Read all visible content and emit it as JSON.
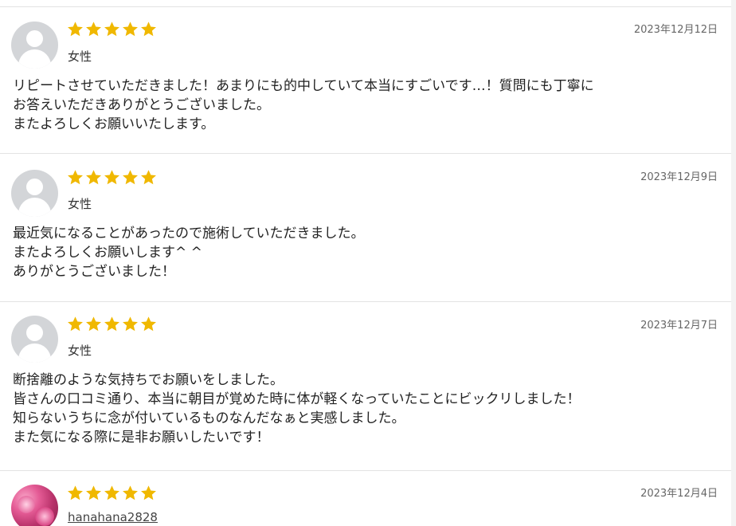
{
  "colors": {
    "star": "#f0b800",
    "border": "#e3e3e3",
    "date": "#666666"
  },
  "reviews": [
    {
      "avatar": "default-user-icon",
      "rating": 5,
      "reviewer": "女性",
      "date": "2023年12月12日",
      "lines": [
        "リピートさせていただきました！あまりにも的中していて本当にすごいです…！質問にも丁寧に",
        "お答えいただきありがとうございました。",
        "またよろしくお願いいたします。"
      ]
    },
    {
      "avatar": "default-user-icon",
      "rating": 5,
      "reviewer": "女性",
      "date": "2023年12月9日",
      "lines": [
        "最近気になることがあったので施術していただきました。",
        "またよろしくお願いします^ ^",
        "ありがとうございました！"
      ]
    },
    {
      "avatar": "default-user-icon",
      "rating": 5,
      "reviewer": "女性",
      "date": "2023年12月7日",
      "lines": [
        "断捨離のような気持ちでお願いをしました。",
        "皆さんの口コミ通り、本当に朝目が覚めた時に体が軽くなっていたことにビックリしました！",
        "知らないうちに念が付いているものなんだなぁと実感しました。",
        "また気になる際に是非お願いしたいです！"
      ]
    },
    {
      "avatar": "user-photo-icon",
      "rating": 5,
      "reviewer": "hanahana2828",
      "date": "2023年12月4日",
      "lines": []
    }
  ]
}
